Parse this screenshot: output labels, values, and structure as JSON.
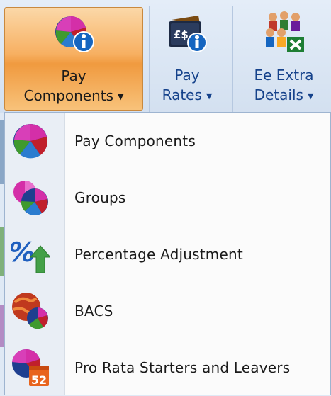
{
  "ribbon": {
    "buttons": [
      {
        "line1": "Pay",
        "line2": "Components",
        "icon": "pay-components-pie-info-icon",
        "active": true
      },
      {
        "line1": "Pay",
        "line2": "Rates",
        "icon": "pay-rates-wallet-info-icon",
        "active": false
      },
      {
        "line1": "Ee Extra",
        "line2": "Details",
        "icon": "employee-extra-details-group-excel-icon",
        "active": false
      }
    ],
    "dropdown_glyph": "▼"
  },
  "menu": {
    "items": [
      {
        "label": "Pay Components",
        "icon": "pie-chart-icon"
      },
      {
        "label": "Groups",
        "icon": "grouped-pie-charts-icon"
      },
      {
        "label": "Percentage Adjustment",
        "icon": "percent-up-arrow-icon"
      },
      {
        "label": "BACS",
        "icon": "bacs-globe-pie-icon"
      },
      {
        "label": "Pro Rata Starters and Leavers",
        "icon": "pie-calendar-52-icon"
      }
    ],
    "calendar_badge": "52"
  },
  "colors": {
    "active_orange": "#f7b062",
    "ribbon_text": "#15428b",
    "menu_background": "#fbfbfb",
    "gutter": "#e9eef5"
  }
}
